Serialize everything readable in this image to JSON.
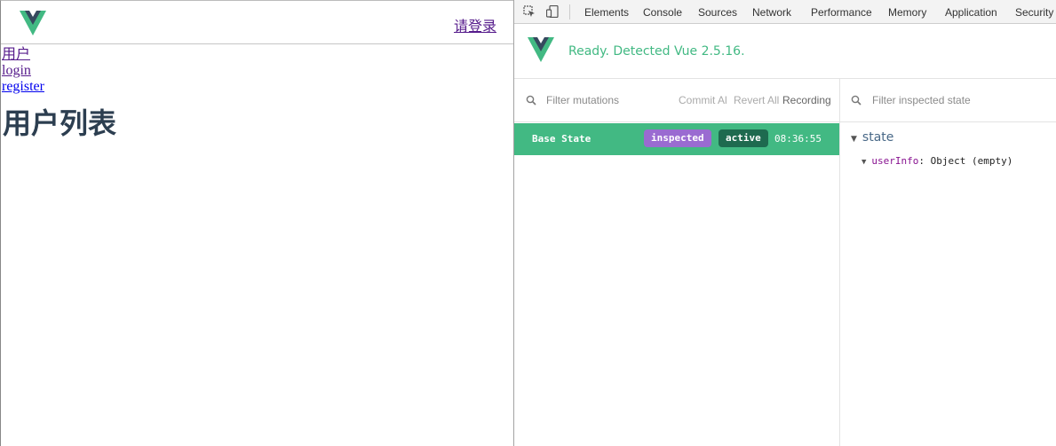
{
  "app": {
    "login_link": "请登录",
    "nav": [
      "用户",
      "login",
      "register"
    ],
    "page_title": "用户列表"
  },
  "devtools": {
    "tabs": [
      "Elements",
      "Console",
      "Sources",
      "Network",
      "Performance",
      "Memory",
      "Application",
      "Security"
    ],
    "vue_status": "Ready. Detected Vue 2.5.16.",
    "mutations": {
      "filter_placeholder": "Filter mutations",
      "commit_all": "Commit Al",
      "revert_all": "Revert All",
      "recording": "Recording",
      "rows": [
        {
          "label": "Base State",
          "inspected_tag": "inspected",
          "active_tag": "active",
          "time": "08:36:55"
        }
      ]
    },
    "state": {
      "filter_placeholder": "Filter inspected state",
      "root": "state",
      "items": [
        {
          "key": "userInfo",
          "value": "Object (empty)"
        }
      ]
    }
  },
  "colors": {
    "vue_green": "#42b983",
    "vue_dark": "#35495e",
    "inspected": "#9a6bd1",
    "active": "#1e6a4f"
  }
}
